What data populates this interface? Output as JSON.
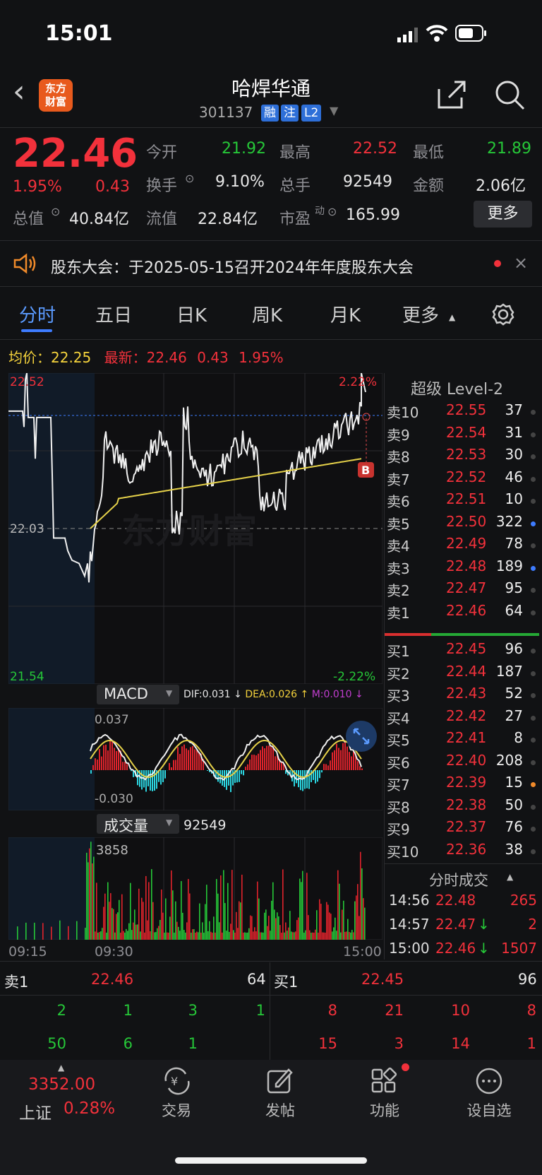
{
  "status_bar": {
    "time": "15:01"
  },
  "header": {
    "title": "哈焊华通",
    "code": "301137",
    "tags": [
      "融",
      "注",
      "L2"
    ],
    "logo": "东方\n财富"
  },
  "quote": {
    "price": "22.46",
    "change_pct": "1.95%",
    "change": "0.43",
    "rows": [
      [
        {
          "label": "今开",
          "value": "21.92",
          "color": "green"
        },
        {
          "label": "最高",
          "value": "22.52",
          "color": "red"
        },
        {
          "label": "最低",
          "value": "21.89",
          "color": "green"
        }
      ],
      [
        {
          "label": "换手",
          "value": "9.10%",
          "color": "white"
        },
        {
          "label": "总手",
          "value": "92549",
          "color": "white"
        },
        {
          "label": "金额",
          "value": "2.06亿",
          "color": "white"
        }
      ]
    ],
    "row3": {
      "zongzhi_label": "总值",
      "zongzhi": "40.84亿",
      "liuzhi_label": "流值",
      "liuzhi": "22.84亿",
      "pe_label": "市盈",
      "pe_sup": "动",
      "pe": "165.99",
      "more": "更多"
    }
  },
  "notice": {
    "text": "股东大会：于2025-05-15召开2024年年度股东大会"
  },
  "tabs": [
    "分时",
    "五日",
    "日K",
    "周K",
    "月K",
    "更多"
  ],
  "chart_info": {
    "avg_label": "均价：",
    "avg": "22.25",
    "latest_label": "最新：",
    "latest": "22.46",
    "chg": "0.43",
    "pct": "1.95%"
  },
  "chart_labels": {
    "high": "22.52",
    "mid": "22.03",
    "low": "21.54",
    "pct_high": "2.22%",
    "pct_low": "-2.22%",
    "b_marker": "B",
    "watermark": "东方财富"
  },
  "macd": {
    "label": "MACD",
    "dif": "DIF:0.031",
    "dea": "DEA:0.026",
    "m": "M:0.010",
    "top": "0.037",
    "bottom": "-0.030"
  },
  "volume": {
    "label": "成交量",
    "total": "92549",
    "max": "3858"
  },
  "time_axis": [
    "09:15",
    "09:30",
    "15:00"
  ],
  "level2": {
    "title": "超级 Level-2",
    "asks": [
      [
        "卖10",
        "22.55",
        "37"
      ],
      [
        "卖9",
        "22.54",
        "31"
      ],
      [
        "卖8",
        "22.53",
        "30"
      ],
      [
        "卖7",
        "22.52",
        "46"
      ],
      [
        "卖6",
        "22.51",
        "10"
      ],
      [
        "卖5",
        "22.50",
        "322"
      ],
      [
        "卖4",
        "22.49",
        "78"
      ],
      [
        "卖3",
        "22.48",
        "189"
      ],
      [
        "卖2",
        "22.47",
        "95"
      ],
      [
        "卖1",
        "22.46",
        "64"
      ]
    ],
    "bids": [
      [
        "买1",
        "22.45",
        "96"
      ],
      [
        "买2",
        "22.44",
        "187"
      ],
      [
        "买3",
        "22.43",
        "52"
      ],
      [
        "买4",
        "22.42",
        "27"
      ],
      [
        "买5",
        "22.41",
        "8"
      ],
      [
        "买6",
        "22.40",
        "208"
      ],
      [
        "买7",
        "22.39",
        "15"
      ],
      [
        "买8",
        "22.38",
        "50"
      ],
      [
        "买9",
        "22.37",
        "76"
      ],
      [
        "买10",
        "22.36",
        "38"
      ]
    ],
    "ticks_title": "分时成交",
    "ticks": [
      [
        "14:56",
        "22.48",
        "265",
        ""
      ],
      [
        "14:57",
        "22.47",
        "2",
        "↓"
      ],
      [
        "15:00",
        "22.46",
        "1507",
        "↓"
      ]
    ]
  },
  "queue": {
    "sell_label": "卖1",
    "sell_price": "22.46",
    "sell_vol": "64",
    "buy_label": "买1",
    "buy_price": "22.45",
    "buy_vol": "96",
    "sell_r1": [
      "2",
      "1",
      "3",
      "1"
    ],
    "sell_r2": [
      "50",
      "6",
      "1"
    ],
    "buy_r1": [
      "8",
      "21",
      "10",
      "8"
    ],
    "buy_r2": [
      "15",
      "3",
      "14",
      "1"
    ]
  },
  "bottom_nav": {
    "index_value": "3352.00",
    "index_name": "上证",
    "index_pct": "0.28%",
    "items": [
      "交易",
      "发帖",
      "功能",
      "设自选"
    ]
  },
  "chart_data": {
    "type": "line",
    "title": "",
    "x": [
      "09:15",
      "09:30",
      "15:00"
    ],
    "series": [
      {
        "name": "",
        "values": [
          22.03,
          22.4,
          22.0,
          22.1,
          22.3,
          22.25,
          22.35,
          22.46
        ]
      }
    ],
    "ylim": [
      21.54,
      22.52
    ]
  }
}
